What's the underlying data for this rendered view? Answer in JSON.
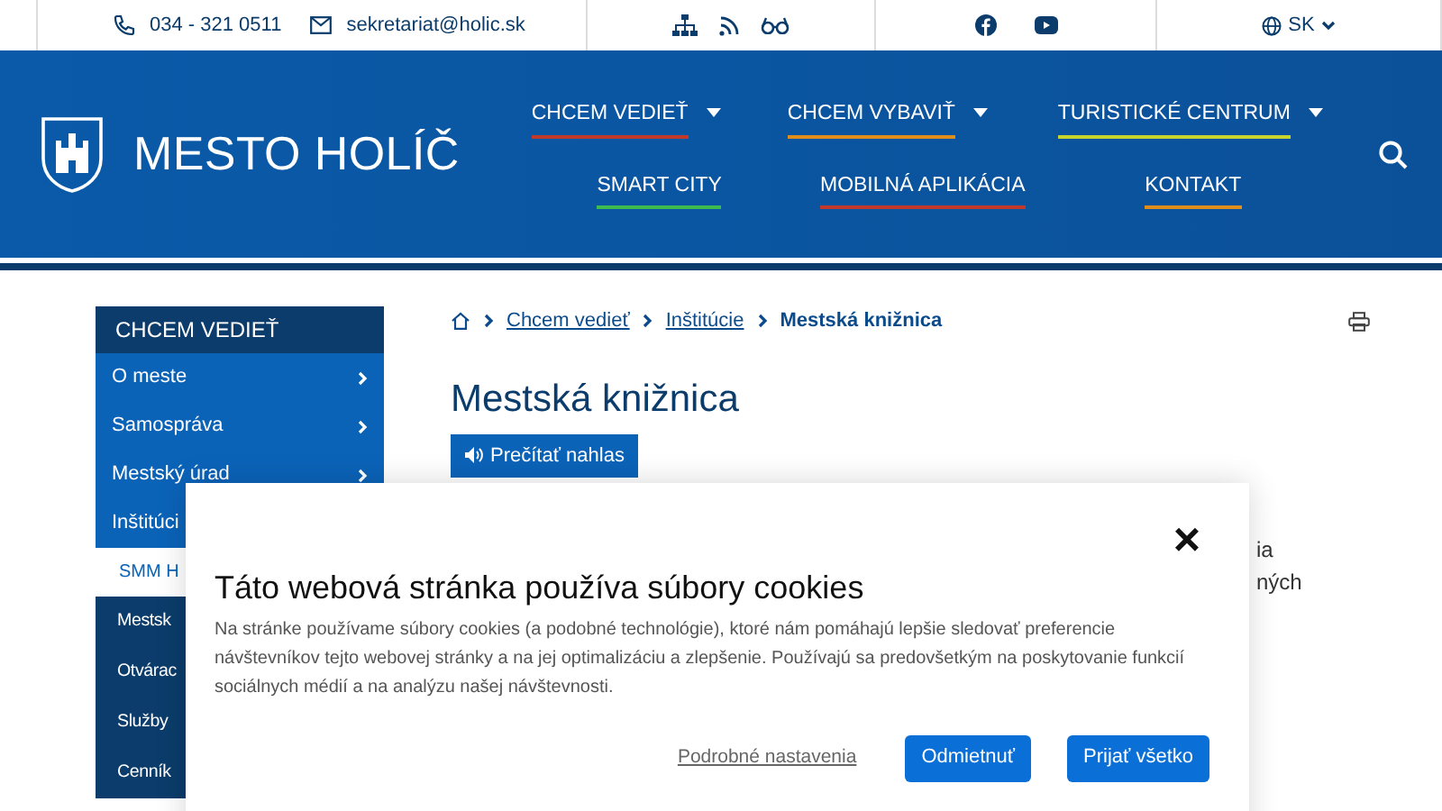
{
  "topbar": {
    "phone": "034 - 321 0511",
    "email": "sekretariat@holic.sk",
    "language": "SK"
  },
  "header": {
    "site_title": "MESTO HOLÍČ",
    "nav": [
      {
        "label": "CHCEM VEDIEŤ",
        "color": "#c0392b",
        "has_dropdown": true
      },
      {
        "label": "CHCEM VYBAVIŤ",
        "color": "#e08e1b",
        "has_dropdown": true
      },
      {
        "label": "TURISTICKÉ CENTRUM",
        "color": "#c8d42e",
        "has_dropdown": true
      },
      {
        "label": "SMART CITY",
        "color": "#3dbb4f",
        "has_dropdown": false
      },
      {
        "label": "MOBILNÁ APLIKÁCIA",
        "color": "#c0392b",
        "has_dropdown": false
      },
      {
        "label": "KONTAKT",
        "color": "#e08e1b",
        "has_dropdown": false
      }
    ]
  },
  "sidebar": {
    "title": "CHCEM VEDIEŤ",
    "items": [
      {
        "label": "O meste",
        "kind": "link",
        "has_arrow": true
      },
      {
        "label": "Samospráva",
        "kind": "link",
        "has_arrow": true
      },
      {
        "label": "Mestský úrad",
        "kind": "link",
        "has_arrow": true
      },
      {
        "label": "Inštitúci",
        "kind": "link",
        "has_arrow": false
      },
      {
        "label": "SMM H",
        "kind": "current",
        "has_arrow": false
      },
      {
        "label": "Mestsk",
        "kind": "sub",
        "has_arrow": false
      },
      {
        "label": "Otvárac",
        "kind": "sub",
        "has_arrow": false
      },
      {
        "label": "Služby",
        "kind": "sub",
        "has_arrow": false
      },
      {
        "label": "Cenník",
        "kind": "sub",
        "has_arrow": false
      }
    ]
  },
  "breadcrumb": [
    {
      "label": "Chcem vedieť",
      "current": false
    },
    {
      "label": "Inštitúcie",
      "current": false
    },
    {
      "label": "Mestská knižnica",
      "current": true
    }
  ],
  "page_title": "Mestská knižnica",
  "read_aloud_button": "Prečítať nahlas",
  "paragraph_fragments": [
    "ia",
    "ných"
  ],
  "cookie_dialog": {
    "close": "×",
    "title": "Táto webová stránka používa súbory cookies",
    "text": "Na stránke používame súbory cookies (a podobné technológie), ktoré nám pomáhajú lepšie sledovať preferencie návštevníkov tejto webovej stránky a na jej optimalizáciu a zlepšenie. Používajú sa predovšetkým na poskytovanie funkcií sociálnych médií a na analýzu našej návštevnosti.",
    "settings_link": "Podrobné nastavenia",
    "buttons": [
      "Odmietnuť",
      "Prijať všetko"
    ]
  }
}
